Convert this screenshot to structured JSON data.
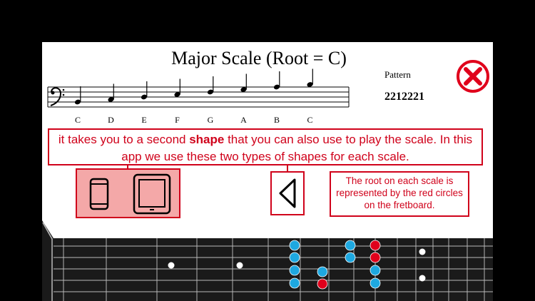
{
  "scale": {
    "title": "Major Scale (Root = C)",
    "pattern_label": "Pattern",
    "pattern_value": "2212221",
    "notes": [
      "C",
      "D",
      "E",
      "F",
      "G",
      "A",
      "B",
      "C"
    ]
  },
  "info": {
    "text_before": "it takes you to a second ",
    "text_bold": "shape",
    "text_after": " that you can also use to play the scale. In this app we use these two types of shapes for each scale."
  },
  "root_note": {
    "text": "The root on each scale is represented by the red circles on the fretboard."
  },
  "icons": {
    "close": "close-icon",
    "phone": "phone-icon",
    "tablet": "tablet-icon",
    "back": "triangle-left-icon"
  },
  "colors": {
    "accent": "#d0021b",
    "note_dot": "#1ea8e0",
    "root_dot": "#e0001b",
    "fretboard": "#1a1a1a",
    "highlight_bg": "#f4a8a8"
  }
}
